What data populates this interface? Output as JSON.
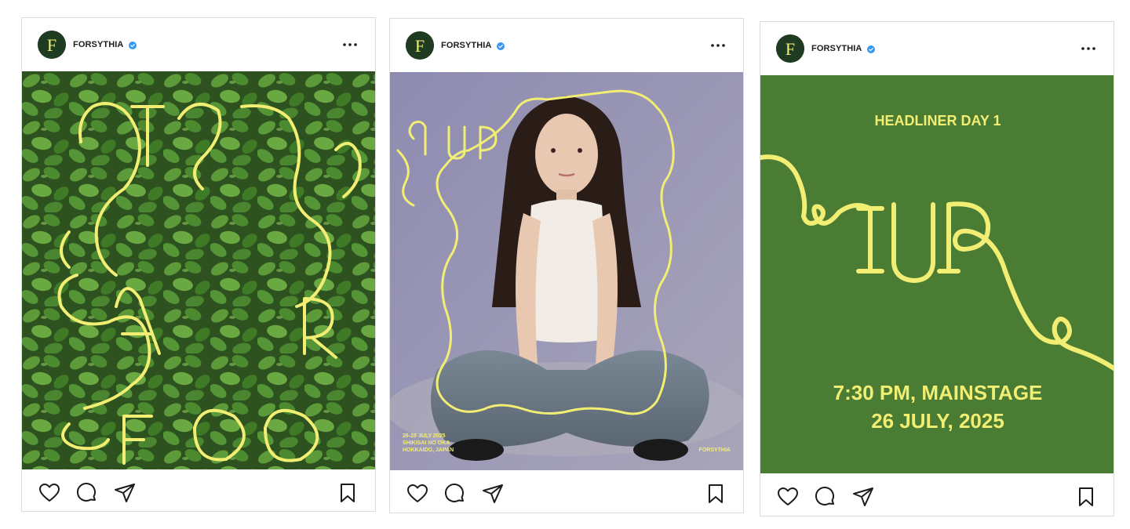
{
  "posts": [
    {
      "username": "FORSYTHIA",
      "avatar_letter": "F",
      "poster_letters": [
        "H",
        "Y",
        "S",
        "F",
        "A",
        "R",
        "F",
        "O",
        "O"
      ],
      "poster_text": "",
      "icons": [
        "heart-icon",
        "comment-icon",
        "share-icon",
        "bookmark-icon"
      ]
    },
    {
      "username": "FORSYTHIA",
      "avatar_letter": "F",
      "artist_lettering": "IU",
      "details": {
        "date": "26-28 JULY 2025",
        "venue": "SHIKISAI NO OKA",
        "location": "HOKKAIDO, JAPAN"
      },
      "brand": "FORSYTHIA",
      "icons": [
        "heart-icon",
        "comment-icon",
        "share-icon",
        "bookmark-icon"
      ]
    },
    {
      "username": "FORSYTHIA",
      "avatar_letter": "F",
      "headline": "HEADLINER DAY 1",
      "artist_lettering": "IU",
      "time_stage": "7:30 PM, MAINSTAGE",
      "date": "26 JULY, 2025",
      "icons": [
        "heart-icon",
        "comment-icon",
        "share-icon",
        "bookmark-icon"
      ]
    }
  ],
  "colors": {
    "brand_dark_green": "#1f3b22",
    "accent_yellow": "#f2ee73",
    "poster_green": "#4a7c34",
    "verified_blue": "#3897f0",
    "foliage_green": "#3f6f2b"
  }
}
